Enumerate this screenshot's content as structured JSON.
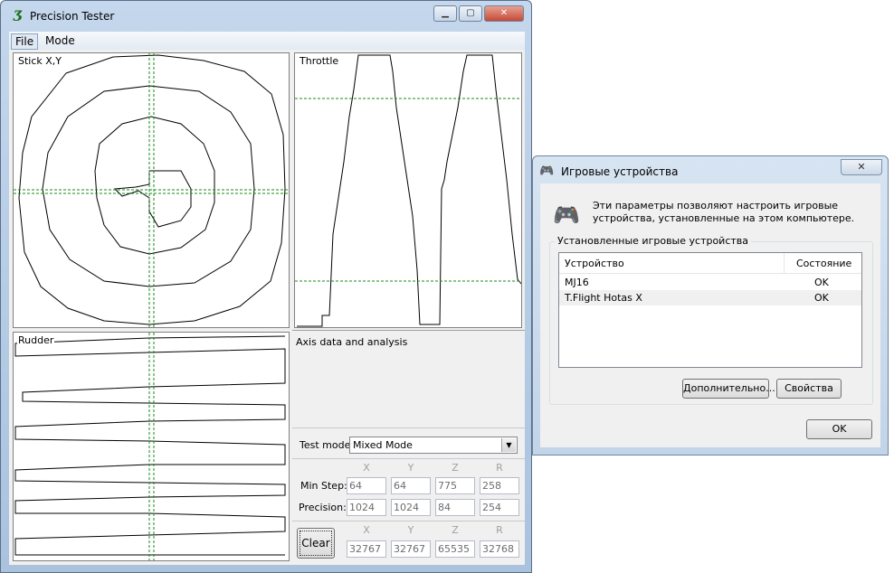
{
  "main_window": {
    "title": "Precision Tester",
    "menu": [
      "File",
      "Mode"
    ],
    "panels": {
      "stick": "Stick X,Y",
      "throttle": "Throttle",
      "rudder": "Rudder"
    },
    "analysis_label": "Axis data and analysis",
    "test_mode": {
      "label": "Test mode:",
      "value": "Mixed Mode"
    },
    "columns": [
      "X",
      "Y",
      "Z",
      "R"
    ],
    "min_step": {
      "label": "Min Step:",
      "values": [
        "64",
        "64",
        "775",
        "258"
      ]
    },
    "precision": {
      "label": "Precision:",
      "values": [
        "1024",
        "1024",
        "84",
        "254"
      ]
    },
    "clear_label": "Clear",
    "raw_values": [
      "32767",
      "32767",
      "65535",
      "32768"
    ]
  },
  "dialog": {
    "title": "Игровые устройства",
    "description": "Эти параметры позволяют настроить игровые устройства, установленные на этом компьютере.",
    "group_label": "Установленные игровые устройства",
    "table": {
      "headers": [
        "Устройство",
        "Состояние"
      ],
      "rows": [
        {
          "device": "MJ16",
          "status": "OK"
        },
        {
          "device": "T.Flight Hotas X",
          "status": "OK"
        }
      ]
    },
    "advanced_button": "Дополнительно...",
    "properties_button": "Свойства",
    "ok_button": "OK"
  },
  "colors": {
    "trace": "#000000",
    "guide": "#1a8a1a"
  }
}
